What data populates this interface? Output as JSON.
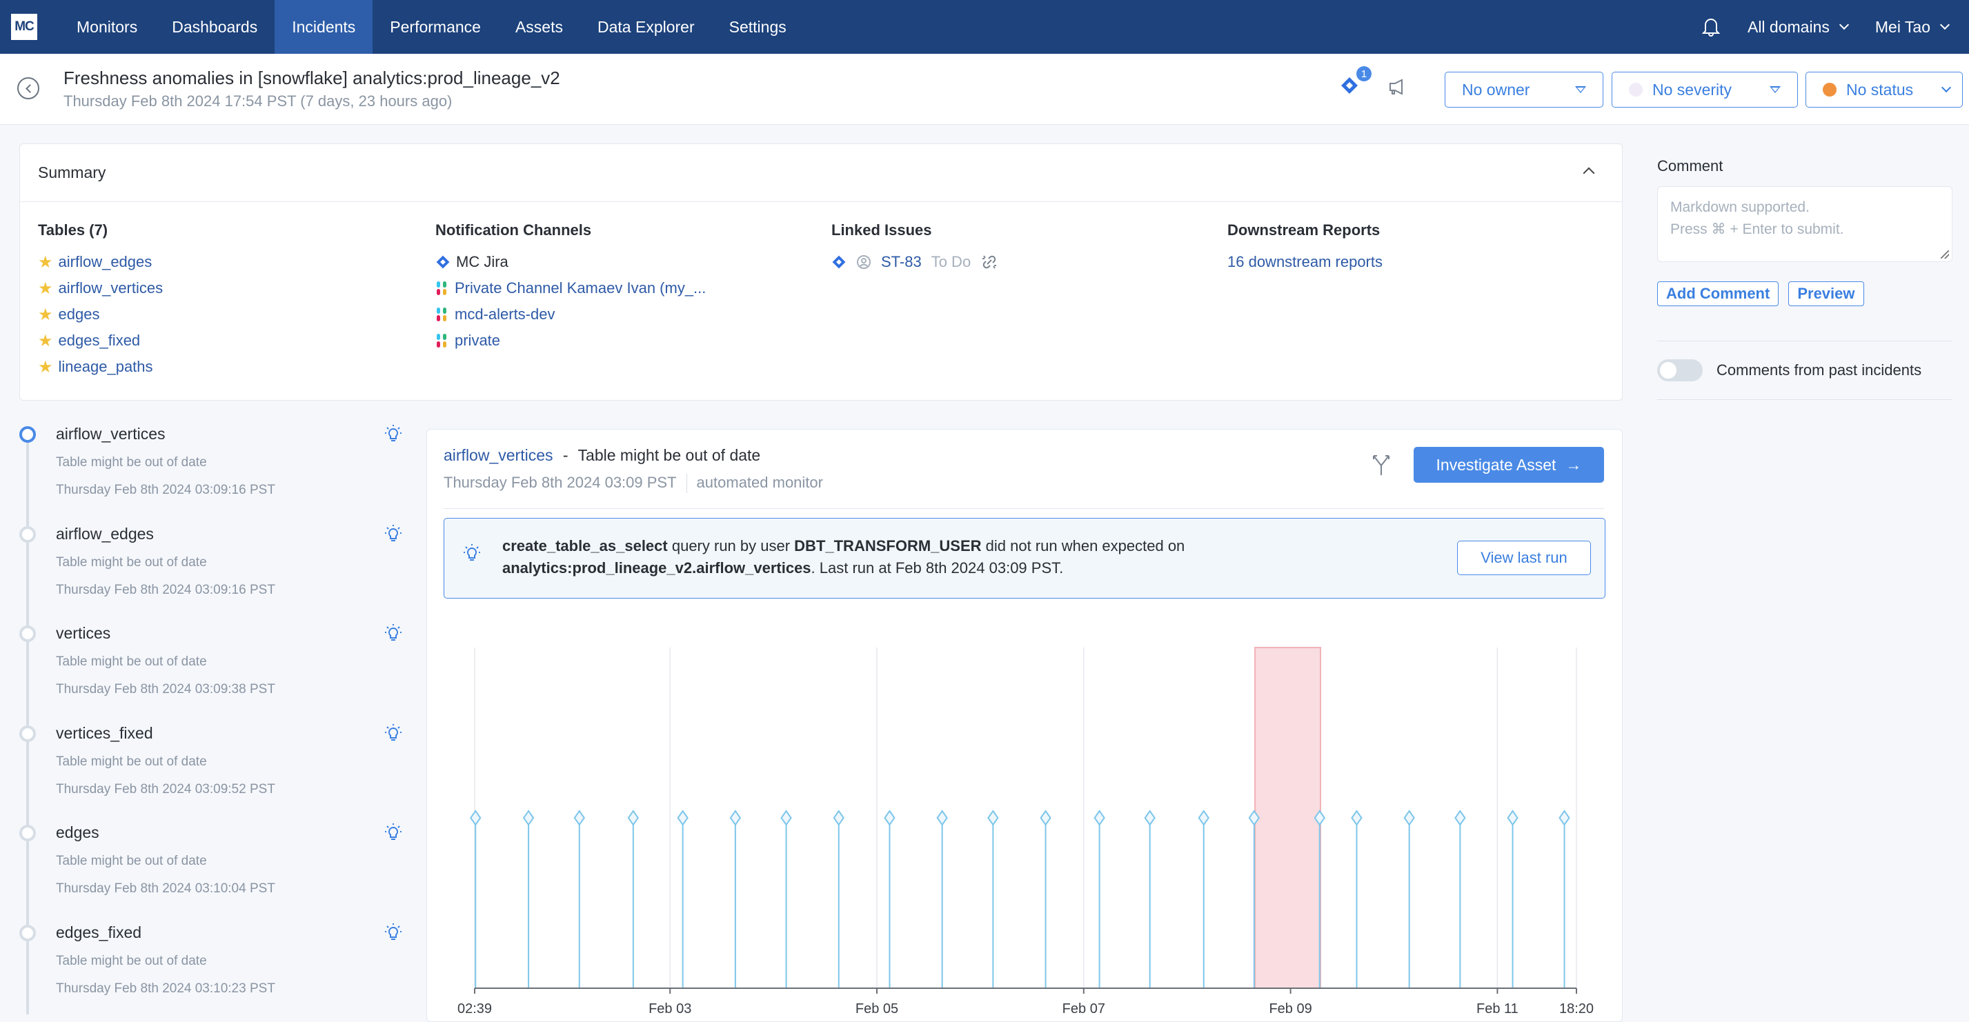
{
  "nav": {
    "logo": "MC",
    "items": [
      "Monitors",
      "Dashboards",
      "Incidents",
      "Performance",
      "Assets",
      "Data Explorer",
      "Settings"
    ],
    "active": "Incidents",
    "domains": "All domains",
    "user": "Mei Tao"
  },
  "header": {
    "title": "Freshness anomalies in [snowflake] analytics:prod_lineage_v2",
    "subtitle": "Thursday Feb 8th 2024 17:54 PST (7 days, 23 hours ago)",
    "jira_badge": "1",
    "owner": "No owner",
    "severity": "No severity",
    "status": "No status",
    "severity_color": "#f1ebf8",
    "status_color": "#f0913e"
  },
  "summary": {
    "title": "Summary",
    "tables_heading": "Tables (7)",
    "tables": [
      "airflow_edges",
      "airflow_vertices",
      "edges",
      "edges_fixed",
      "lineage_paths"
    ],
    "channels_heading": "Notification Channels",
    "channels": [
      {
        "type": "jira",
        "label": "MC Jira"
      },
      {
        "type": "slack",
        "label": "Private Channel Kamaev Ivan (my_..."
      },
      {
        "type": "slack",
        "label": "mcd-alerts-dev"
      },
      {
        "type": "slack",
        "label": "private"
      }
    ],
    "linked_heading": "Linked Issues",
    "linked_issue": {
      "key": "ST-83",
      "status": "To Do"
    },
    "downstream_heading": "Downstream Reports",
    "downstream_link": "16 downstream reports"
  },
  "timeline": [
    {
      "name": "airflow_vertices",
      "desc": "Table might be out of date",
      "time": "Thursday Feb 8th 2024 03:09:16 PST",
      "active": true
    },
    {
      "name": "airflow_edges",
      "desc": "Table might be out of date",
      "time": "Thursday Feb 8th 2024 03:09:16 PST"
    },
    {
      "name": "vertices",
      "desc": "Table might be out of date",
      "time": "Thursday Feb 8th 2024 03:09:38 PST"
    },
    {
      "name": "vertices_fixed",
      "desc": "Table might be out of date",
      "time": "Thursday Feb 8th 2024 03:09:52 PST"
    },
    {
      "name": "edges",
      "desc": "Table might be out of date",
      "time": "Thursday Feb 8th 2024 03:10:04 PST"
    },
    {
      "name": "edges_fixed",
      "desc": "Table might be out of date",
      "time": "Thursday Feb 8th 2024 03:10:23 PST"
    }
  ],
  "detail": {
    "table_link": "airflow_vertices",
    "separator": "-",
    "event": "Table might be out of date",
    "time": "Thursday Feb 8th 2024 03:09 PST",
    "monitor": "automated monitor",
    "investigate": "Investigate Asset",
    "insight": {
      "query": "create_table_as_select",
      "t1": " query run by user ",
      "user": "DBT_TRANSFORM_USER",
      "t2": " did not run when expected on ",
      "table": "analytics:prod_lineage_v2.airflow_vertices",
      "t3": ". Last run at Feb 8th 2024 03:09 PST."
    },
    "view_last_run": "View last run"
  },
  "comment": {
    "label": "Comment",
    "placeholder": "Markdown supported.\nPress ⌘ + Enter to submit.",
    "add": "Add Comment",
    "preview": "Preview",
    "past_toggle_label": "Comments from past incidents",
    "past_toggle_on": false
  },
  "chart_data": {
    "type": "scatter",
    "title": "",
    "xlabel": "",
    "ylabel": "",
    "x_unit": "hours since Feb 1 02:39",
    "x_range_hours": [
      0,
      255.7
    ],
    "tick_labels": [
      {
        "label": "02:39",
        "hours": 0
      },
      {
        "label": "Feb 03",
        "hours": 45.35
      },
      {
        "label": "Feb 05",
        "hours": 93.35
      },
      {
        "label": "Feb 07",
        "hours": 141.35
      },
      {
        "label": "Feb 09",
        "hours": 189.35
      },
      {
        "label": "Feb 11",
        "hours": 237.35
      },
      {
        "label": "18:20",
        "hours": 255.7
      }
    ],
    "updates_hours": [
      0.2,
      12.5,
      24.3,
      36.8,
      48.3,
      60.5,
      72.3,
      84.5,
      96.3,
      108.5,
      120.3,
      132.5,
      145.0,
      156.7,
      169.2,
      180.9,
      196.1,
      204.7,
      216.9,
      228.7,
      240.9,
      252.9
    ],
    "update_level": 0.5,
    "anomaly_window_hours": [
      181.1,
      196.3
    ],
    "colors": {
      "update": "#7ec6ea",
      "anomaly": "#f9dde0",
      "anomaly_border": "#f1b2b8",
      "grid": "#e7e7ee",
      "axis": "#6b6f76"
    },
    "grid": true
  }
}
